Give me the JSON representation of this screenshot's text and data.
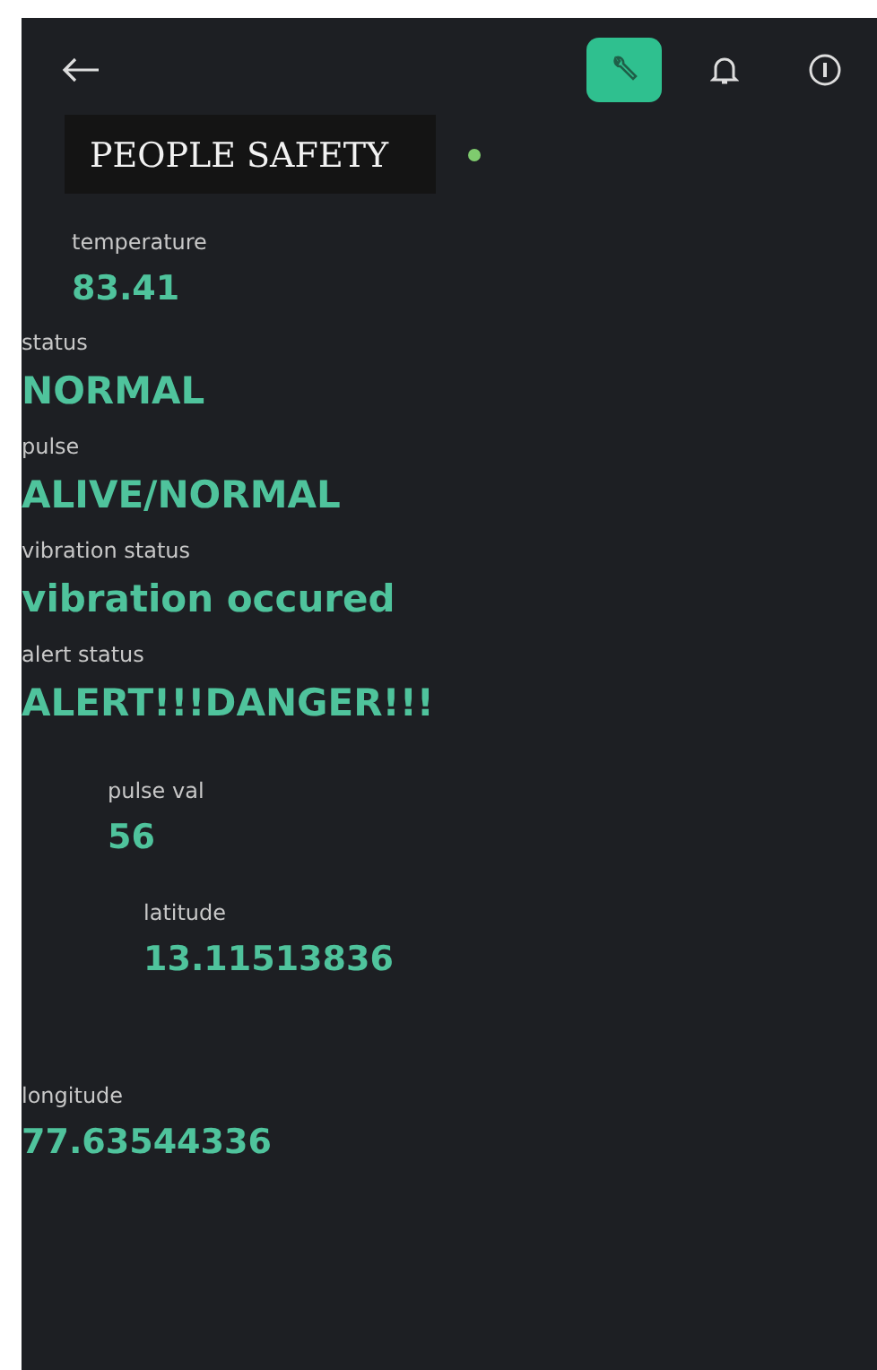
{
  "toolbar": {
    "buttons": [
      {
        "kind": "wrench",
        "selected": true
      },
      {
        "kind": "bell",
        "selected": false
      },
      {
        "kind": "info",
        "selected": false
      }
    ]
  },
  "title": "PEOPLE SAFETY",
  "widgets": [
    {
      "label": "temperature",
      "value": "83.41"
    },
    {
      "label": "status",
      "value": "NORMAL"
    },
    {
      "label": "pulse",
      "value": "ALIVE/NORMAL"
    },
    {
      "label": "vibration status",
      "value": "vibration occured"
    },
    {
      "label": "alert status",
      "value": "ALERT!!!DANGER!!!"
    },
    {
      "label": "pulse val",
      "value": "56"
    },
    {
      "label": "latitude",
      "value": "13.11513836"
    },
    {
      "label": "longitude",
      "value": "77.63544336"
    }
  ]
}
